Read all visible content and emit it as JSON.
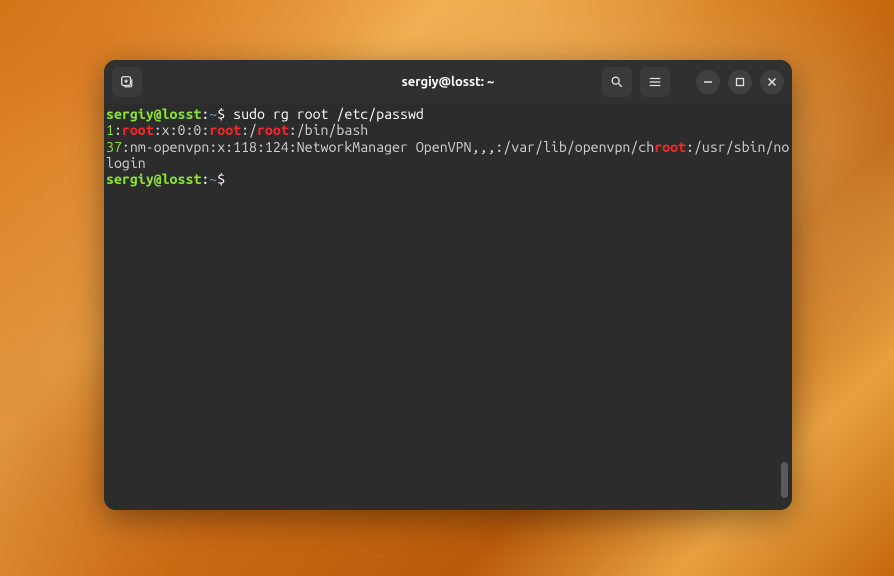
{
  "window": {
    "title": "sergiy@losst: ~"
  },
  "icons": {
    "newtab": "new-tab-icon",
    "search": "search-icon",
    "menu": "hamburger-menu-icon",
    "minimize": "minimize-icon",
    "maximize": "maximize-icon",
    "close": "close-icon"
  },
  "terminal": {
    "prompt": {
      "user_host": "sergiy@losst",
      "sep": ":",
      "path": "~",
      "symbol": "$"
    },
    "command": "sudo rg root /etc/passwd",
    "line1": {
      "num": "1",
      "c1": ":",
      "r1": "root",
      "mid1": ":x:0:0:",
      "r2": "root",
      "mid2": ":/",
      "r3": "root",
      "tail": ":/bin/bash"
    },
    "line2": {
      "num": "37",
      "c1": ":nm-openvpn:x:118:124:NetworkManager OpenVPN,,,:/var/lib/openvpn/ch",
      "r1": "root",
      "tail": ":/usr/sbin/nologin"
    }
  }
}
